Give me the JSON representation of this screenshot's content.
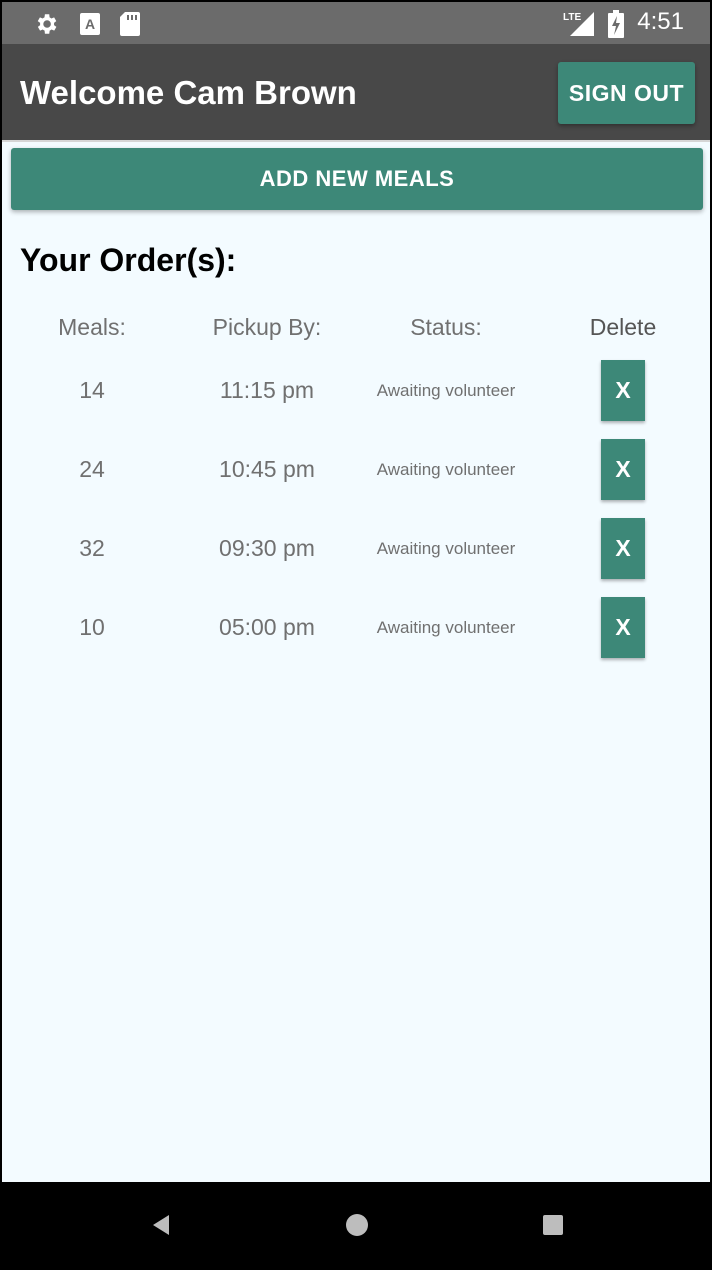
{
  "status_bar": {
    "time": "4:51",
    "network": "LTE",
    "icons": [
      "settings-gear-icon",
      "font-a-icon",
      "sd-card-icon",
      "signal-icon",
      "battery-charging-icon"
    ]
  },
  "app_bar": {
    "title": "Welcome Cam Brown",
    "sign_out_label": "SIGN OUT"
  },
  "add_meals_label": "ADD NEW MEALS",
  "orders_title": "Your Order(s):",
  "table": {
    "headers": {
      "meals": "Meals:",
      "pickup": "Pickup By:",
      "status": "Status:",
      "delete": "Delete"
    },
    "rows": [
      {
        "meals": "14",
        "pickup": "11:15 pm",
        "status": "Awaiting volunteer",
        "delete_label": "X"
      },
      {
        "meals": "24",
        "pickup": "10:45 pm",
        "status": "Awaiting volunteer",
        "delete_label": "X"
      },
      {
        "meals": "32",
        "pickup": "09:30 pm",
        "status": "Awaiting volunteer",
        "delete_label": "X"
      },
      {
        "meals": "10",
        "pickup": "05:00 pm",
        "status": "Awaiting volunteer",
        "delete_label": "X"
      }
    ]
  },
  "nav_bar": {
    "icons": [
      "back-triangle-icon",
      "home-circle-icon",
      "recents-square-icon"
    ]
  },
  "colors": {
    "accent": "#3d8878",
    "app_bar": "#484848",
    "background": "#f3fbff"
  }
}
